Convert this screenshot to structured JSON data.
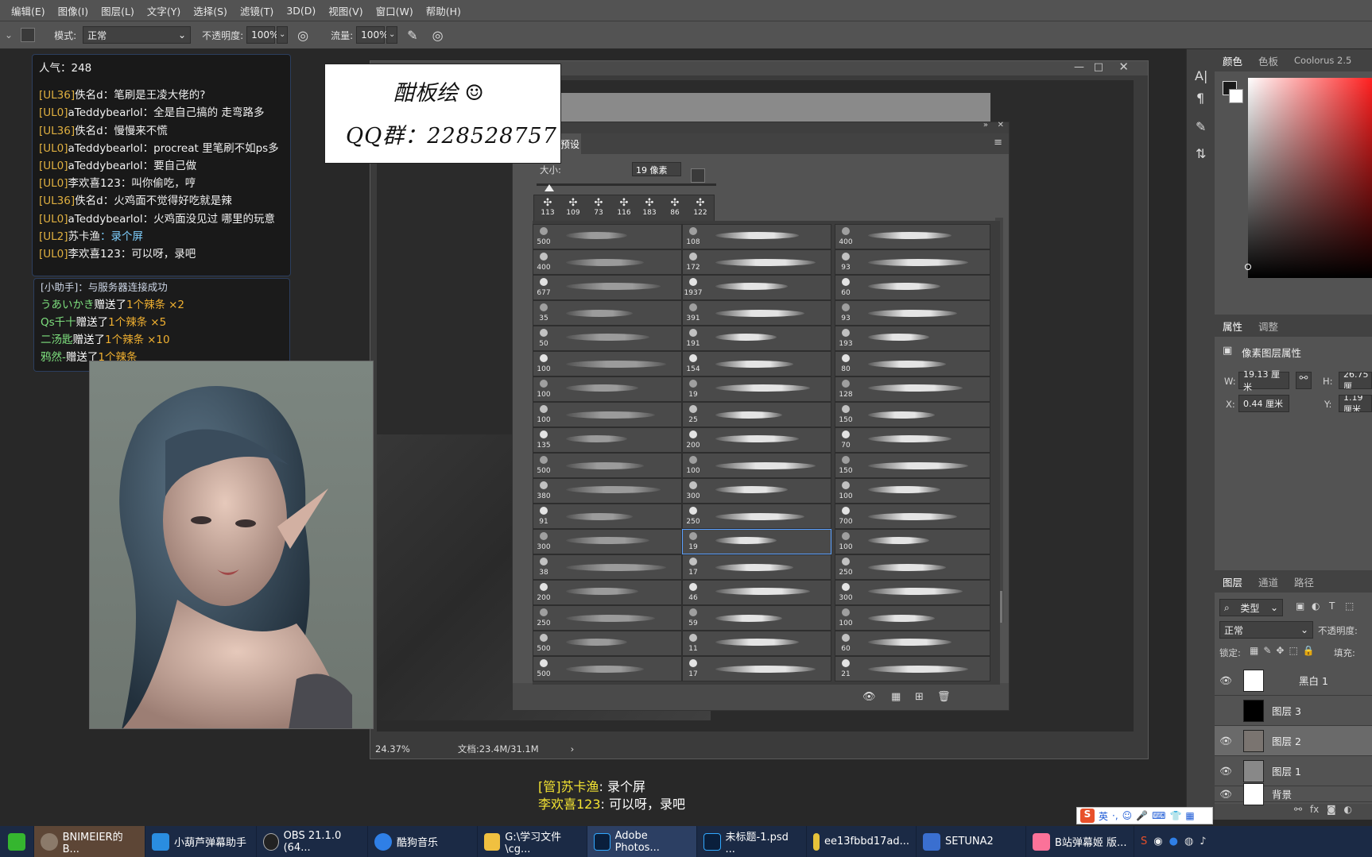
{
  "menu": [
    "编辑(E)",
    "图像(I)",
    "图层(L)",
    "文字(Y)",
    "选择(S)",
    "滤镜(T)",
    "3D(D)",
    "视图(V)",
    "窗口(W)",
    "帮助(H)"
  ],
  "options": {
    "mode_label": "模式:",
    "mode_value": "正常",
    "opacity_label": "不透明度:",
    "opacity_value": "100%",
    "flow_label": "流量:",
    "flow_value": "100%"
  },
  "chat": {
    "popularity": "人气：248",
    "messages": [
      {
        "level": "[UL36]",
        "user": "佚名d",
        "text": "：笔刷是王凌大佬的?"
      },
      {
        "level": "[UL0]",
        "user": "aTeddybearlol",
        "text": "：全是自己搞的 走弯路多"
      },
      {
        "level": "[UL36]",
        "user": "佚名d",
        "text": "：慢慢来不慌"
      },
      {
        "level": "[UL0]",
        "user": "aTeddybearlol",
        "text": "：procreat 里笔刷不如ps多"
      },
      {
        "level": "[UL0]",
        "user": "aTeddybearlol",
        "text": "：要自己做"
      },
      {
        "level": "[UL0]",
        "user": "李欢喜123",
        "text": "：叫你偷吃，哼"
      },
      {
        "level": "[UL36]",
        "user": "佚名d",
        "text": "：火鸡面不觉得好吃就是辣"
      },
      {
        "level": "[UL0]",
        "user": "aTeddybearlol",
        "text": "：火鸡面没见过 哪里的玩意"
      },
      {
        "level": "[UL2]",
        "user": "苏卡渔",
        "text": "：录个屏"
      },
      {
        "level": "[UL0]",
        "user": "李欢喜123",
        "text": "：可以呀，录吧"
      }
    ]
  },
  "gifts": {
    "system": "[小助手]：与服务器连接成功",
    "items": [
      {
        "user": "うあいかき",
        "action": "赠送了",
        "count": "1",
        "item": "个辣条",
        "mult": "×2"
      },
      {
        "user": "Qs千十",
        "action": "赠送了",
        "count": "1",
        "item": "个辣条",
        "mult": "×5"
      },
      {
        "user": "二汤匙",
        "action": "赠送了",
        "count": "1",
        "item": "个辣条",
        "mult": "×10"
      },
      {
        "user": "鸦然-",
        "action": "赠送了",
        "count": "1",
        "item": "个辣条",
        "mult": ""
      }
    ]
  },
  "overlay": {
    "line1": "酣板绘 ☺",
    "line2": "QQ群：228528757"
  },
  "brush_panel": {
    "title": "预设",
    "size_label": "大小:",
    "size_value": "19 像素",
    "recent_sizes": [
      "113",
      "109",
      "73",
      "116",
      "183",
      "86",
      "122"
    ],
    "col1": [
      "500",
      "400",
      "677",
      "35",
      "50",
      "100",
      "100",
      "100",
      "135",
      "500",
      "380",
      "91",
      "300",
      "38",
      "200",
      "250",
      "500",
      "500"
    ],
    "col2": [
      "108",
      "172",
      "1937",
      "391",
      "191",
      "154",
      "19",
      "25",
      "200",
      "100",
      "300",
      "250",
      "19",
      "17",
      "46",
      "59",
      "11",
      "17"
    ],
    "col3": [
      "400",
      "93",
      "60",
      "93",
      "193",
      "80",
      "128",
      "150",
      "70",
      "150",
      "100",
      "700",
      "100",
      "250",
      "300",
      "100",
      "60",
      "21"
    ]
  },
  "status": {
    "zoom": "24.37%",
    "doc": "文档:23.4M/31.1M"
  },
  "right": {
    "color_tabs": [
      "颜色",
      "色板",
      "Coolorus 2.5"
    ],
    "props_tabs": [
      "属性",
      "调整"
    ],
    "props_title": "像素图层属性",
    "w_label": "W:",
    "w_value": "19.13 厘米",
    "h_label": "H:",
    "h_value": "26.75 厘",
    "x_label": "X:",
    "x_value": "0.44 厘米",
    "y_label": "Y:",
    "y_value": "1.19 厘米",
    "layer_tabs": [
      "图层",
      "通道",
      "路径"
    ],
    "kind": "类型",
    "blend": "正常",
    "opacity_label": "不透明度:",
    "lock_label": "锁定:",
    "fill_label": "填充:",
    "layers": [
      "黑白 1",
      "图层 3",
      "图层 2",
      "图层 1",
      "背景"
    ]
  },
  "subtitle": {
    "l1_tag": "[管]苏卡渔",
    "l1_text": ": 录个屏",
    "l2_tag": "李欢喜123",
    "l2_text": ": 可以呀，录吧"
  },
  "ime": "英",
  "taskbar": [
    "BNIMEIER的B...",
    "小葫芦弹幕助手",
    "OBS 21.1.0 (64...",
    "酷狗音乐",
    "G:\\学习文件\\cg...",
    "Adobe Photos...",
    "未标题-1.psd ...",
    "ee13fbbd17ad...",
    "SETUNA2",
    "B站弹幕姬 版..."
  ]
}
